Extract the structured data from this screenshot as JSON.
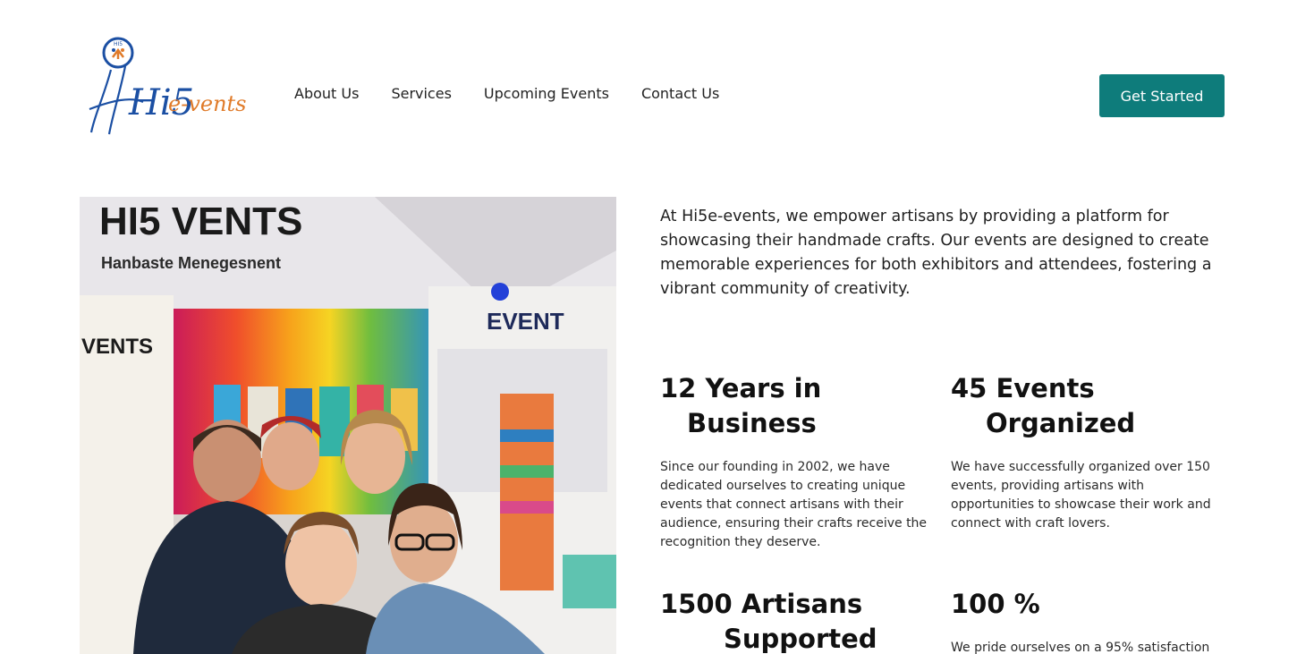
{
  "brand": {
    "logo_text_main": "Hi5",
    "logo_text_suffix": "e-vents",
    "logo_badge": "HI5"
  },
  "nav": {
    "items": [
      {
        "label": "About Us"
      },
      {
        "label": "Services"
      },
      {
        "label": "Upcoming Events"
      },
      {
        "label": "Contact Us"
      }
    ],
    "cta_label": "Get Started"
  },
  "photo": {
    "banner_title": "HI5 VENTS",
    "banner_subtitle": "Hanbaste Menegesnent",
    "left_banner_title": "VENTS",
    "right_banner_title": "EVENT"
  },
  "intro": {
    "text": "At Hi5e-events, we empower artisans by providing a platform for showcasing their handmade crafts. Our events are designed to create memorable experiences for both exhibitors and attendees, fostering a vibrant community of creativity."
  },
  "stats": [
    {
      "line1": "12 Years in",
      "line2": "Business",
      "description": "Since our founding in 2002, we have dedicated ourselves to creating unique events that connect artisans with their audience, ensuring their crafts receive the recognition they deserve."
    },
    {
      "line1": "45 Events",
      "line2": "Organized",
      "description": "We have successfully organized over 150 events, providing artisans with opportunities to showcase their work and connect with craft lovers."
    },
    {
      "line1": "1500 Artisans",
      "line2": "Supported",
      "description": ""
    },
    {
      "line1": "100 %",
      "line2": "",
      "description": "We pride ourselves on a 95% satisfaction"
    }
  ],
  "colors": {
    "accent": "#0e7c7b",
    "logo_blue": "#1b4fa3",
    "logo_orange": "#e07b2a"
  }
}
